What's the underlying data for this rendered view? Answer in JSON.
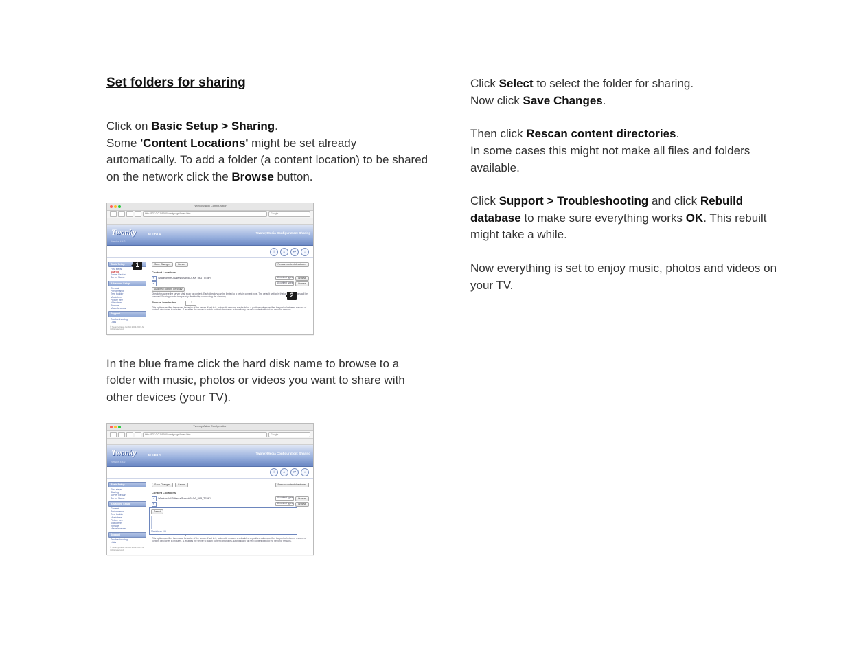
{
  "left": {
    "heading": "Set folders for sharing",
    "p1_a": "Click on ",
    "p1_b": "Basic Setup > Sharing",
    "p1_c": ".",
    "p2_a": "Some ",
    "p2_b": "'Content Locations'",
    "p2_c": " might be set already automatically. To add a folder (a content location) to be shared on the network click the ",
    "p2_d": "Browse",
    "p2_e": " button.",
    "p3": "In the blue frame click the hard disk name to browse to a folder with music, photos or videos you want to share with other devices (your TV)."
  },
  "right": {
    "p1_a": "Click ",
    "p1_b": "Select",
    "p1_c": " to select the folder for sharing.",
    "p2_a": "Now click ",
    "p2_b": "Save Changes",
    "p2_c": ".",
    "p3_a": "Then click ",
    "p3_b": "Rescan content directories",
    "p3_c": ".",
    "p4": "In some cases this might not make all files and folders available.",
    "p5_a": "Click ",
    "p5_b": "Support > Troubleshooting",
    "p5_c": " and click ",
    "p5_d": "Rebuild database",
    "p5_e": " to make sure  everything works ",
    "p5_f": "OK",
    "p5_g": ". This rebuilt might take a while.",
    "p6": "Now everything is set to enjoy music, photos and videos on your TV."
  },
  "shot": {
    "windowTitle": "TwonkyVision Configuration",
    "url": "http://127.0.0.1:9000/configpage/index.htm",
    "searchPlaceholder": "Google",
    "logo": "Twonky",
    "logoSub": "MEDIA",
    "version": "Version 4.4.2",
    "configLabel": "TwonkyMedia Configuration: Sharing",
    "icons": [
      "i",
      "⌂",
      "⇄",
      "↓"
    ],
    "sidebar": {
      "h1": "Basic Setup",
      "g1": [
        "First steps",
        "Sharing",
        "Server Restart",
        "Server Name"
      ],
      "h2": "Advanced Setup",
      "g2": [
        "General",
        "Performance",
        "Tree builder",
        "Music tree",
        "Picture tree",
        "Video tree",
        "Remote",
        "Miscellaneous"
      ],
      "h3": "Support",
      "g3": [
        "Troubleshooting",
        "Links"
      ],
      "foot": "© TwonkyVision GmbH\n2003-2007\nAll rights reserved"
    },
    "buttons": {
      "save": "Save Changes",
      "cancel": "Cancel",
      "rescan": "Rescan content directories",
      "browse": "Browse",
      "select": "Select",
      "addNew": "Add new content directory"
    },
    "sections": {
      "contentLocations": "Content Locations",
      "rescanInterval": "Rescan in minutes",
      "rescanValue": "-1"
    },
    "path": "/Macintosh HD/Users/Shared/DLNA_IMG_TEMP/",
    "contentType": "All content types",
    "help1": "Directories where the server shall scan for content. Each directory can be limited to a certain content type. The default setting is that all content types will be scanned. Sharing can be temporarily disabled by unchecking the directory.",
    "help2": "This option specifies the rescan behavior of the server. If set to 0, automatic rescans are disabled. A positive value specifies the period between rescans of content directories in minutes. -1 enables the server to watch content directories automatically for new content without the need for rescans.",
    "popLink": "Macintosh HD"
  },
  "markers": {
    "m1": "1",
    "m2": "2"
  }
}
